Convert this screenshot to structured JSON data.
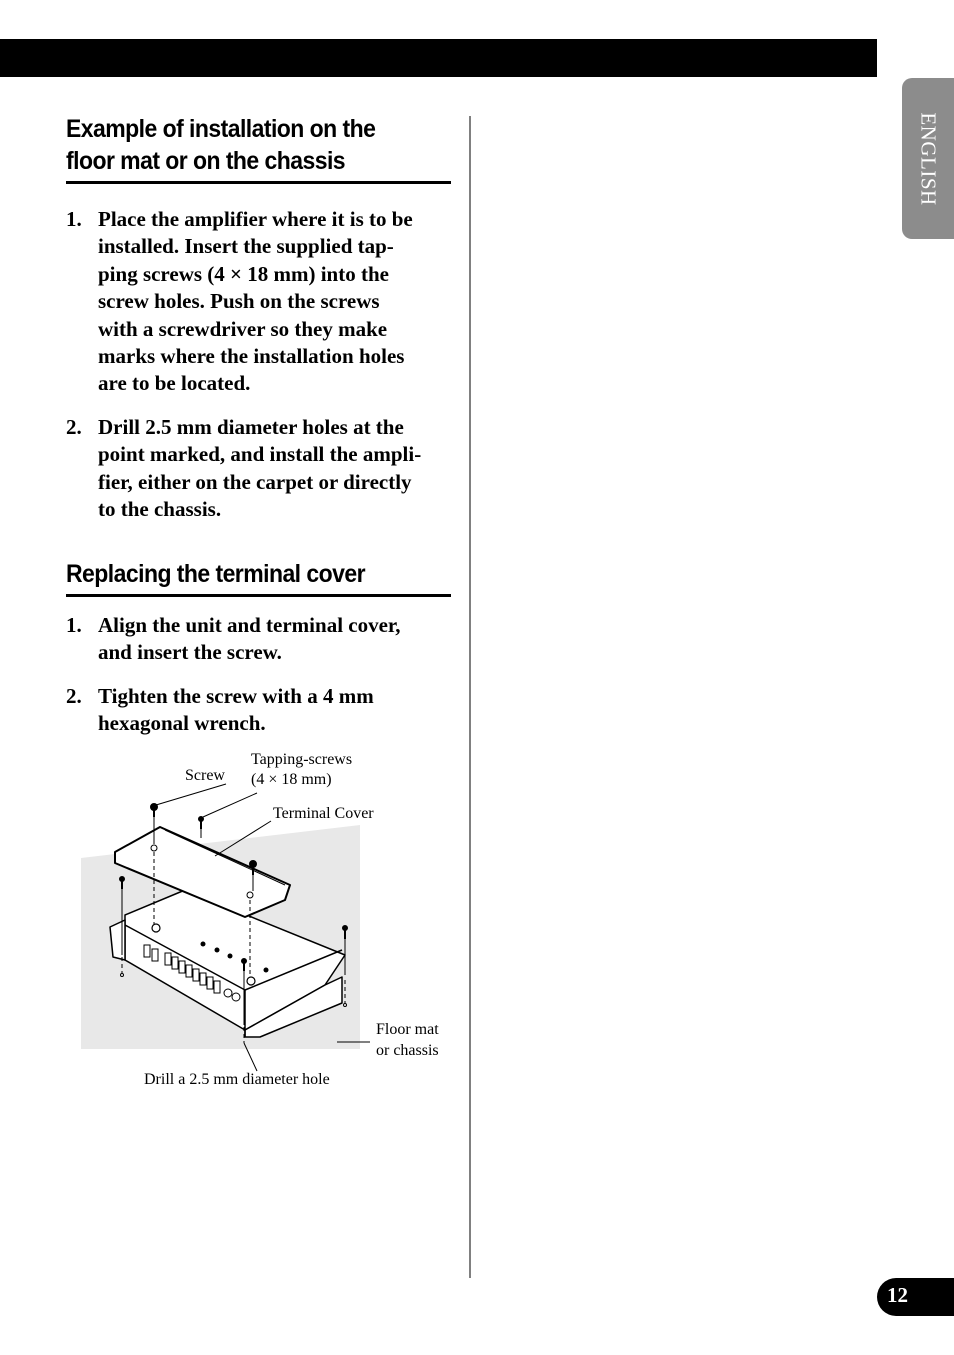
{
  "header": {
    "language_tab": "ENGLISH"
  },
  "sections": [
    {
      "title_lines": [
        "Example of installation on the",
        "floor mat or on the chassis"
      ],
      "steps": [
        {
          "num": "1.",
          "lines": [
            "Place the amplifier where it is to be",
            "installed. Insert the supplied tap-",
            "ping screws (4 × 18 mm) into the",
            "screw holes. Push on the screws",
            "with a screwdriver so they make",
            "marks where the installation holes",
            "are to be located."
          ]
        },
        {
          "num": "2.",
          "lines": [
            "Drill 2.5 mm diameter holes at the",
            "point marked, and install the ampli-",
            "fier, either on the carpet or directly",
            "to the chassis."
          ]
        }
      ]
    },
    {
      "title_lines": [
        "Replacing the terminal cover"
      ],
      "steps": [
        {
          "num": "1.",
          "lines": [
            "Align the unit and terminal cover,",
            "and insert the screw."
          ]
        },
        {
          "num": "2.",
          "lines": [
            "Tighten the screw with a 4 mm",
            "hexagonal wrench."
          ]
        }
      ]
    }
  ],
  "figure": {
    "labels": {
      "screw": "Screw",
      "tapping_screws_1": "Tapping-screws",
      "tapping_screws_2": "(4 × 18 mm)",
      "terminal_cover": "Terminal Cover",
      "floor_mat_1": "Floor mat",
      "floor_mat_2": "or chassis",
      "drill_hole": "Drill a 2.5 mm diameter hole"
    }
  },
  "footer": {
    "page_number": "12"
  },
  "colors": {
    "tab_gray": "#8c8c8c",
    "floor_gray": "#e8e8e8",
    "divider": "#808080"
  }
}
